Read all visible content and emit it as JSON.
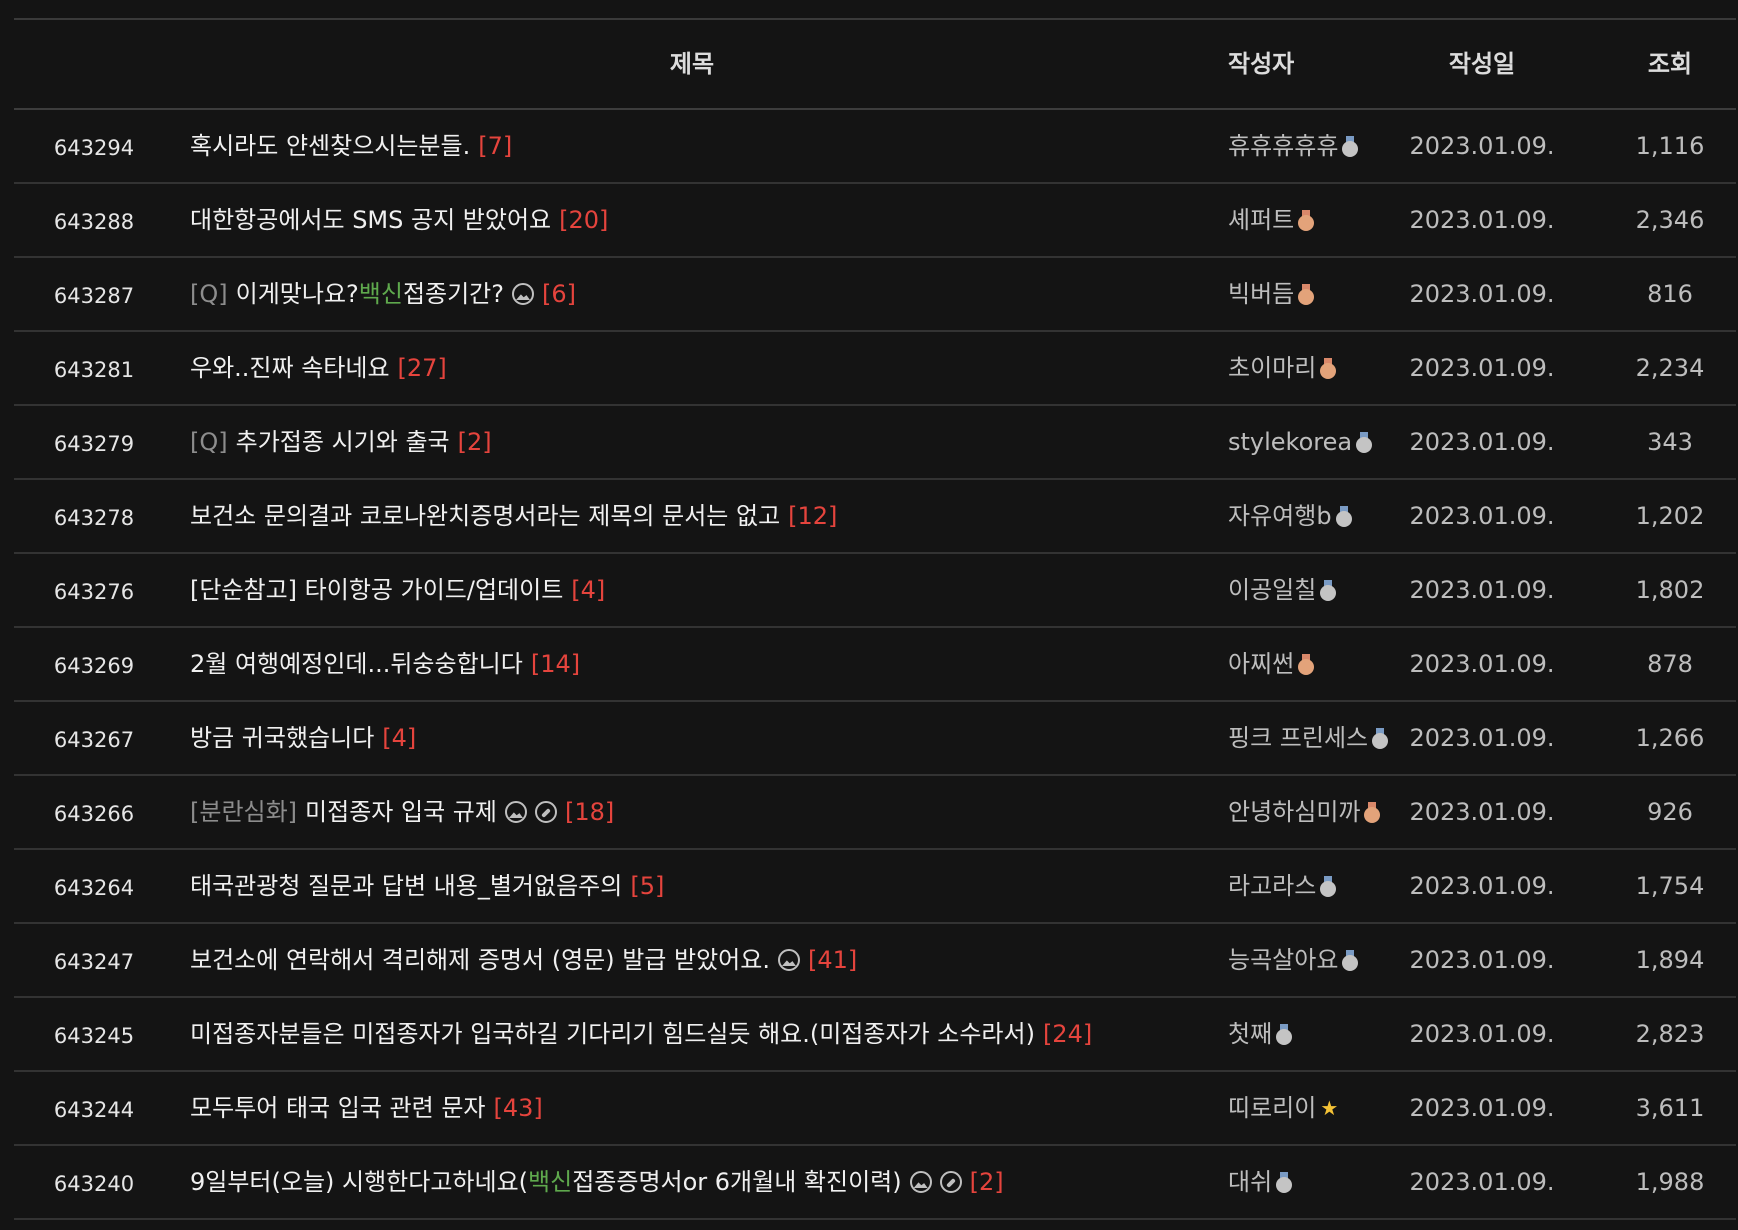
{
  "header": {
    "title": "제목",
    "author": "작성자",
    "date": "작성일",
    "views": "조회"
  },
  "colors": {
    "background": "#141414",
    "comment_count": "#e5443d",
    "highlight": "#5fa94d",
    "prefix": "#8d8d8d"
  },
  "posts": [
    {
      "num": "643294",
      "prefix": "",
      "parts": [
        {
          "t": "혹시라도 얀센찾으시는분들."
        }
      ],
      "icons": [],
      "comments": "[7]",
      "author": "휴휴휴휴휴",
      "medal": "silver",
      "date": "2023.01.09.",
      "views": "1,116"
    },
    {
      "num": "643288",
      "prefix": "",
      "parts": [
        {
          "t": "대한항공에서도 SMS 공지 받았어요"
        }
      ],
      "icons": [],
      "comments": "[20]",
      "author": "셰퍼트",
      "medal": "bronze",
      "date": "2023.01.09.",
      "views": "2,346"
    },
    {
      "num": "643287",
      "prefix": "[Q]",
      "parts": [
        {
          "t": "이게맞나요?"
        },
        {
          "t": "백신",
          "hl": true
        },
        {
          "t": "접종기간?"
        }
      ],
      "icons": [
        "image-icon"
      ],
      "comments": "[6]",
      "author": "빅버듬",
      "medal": "bronze",
      "date": "2023.01.09.",
      "views": "816"
    },
    {
      "num": "643281",
      "prefix": "",
      "parts": [
        {
          "t": "우와..진짜 속타네요"
        }
      ],
      "icons": [],
      "comments": "[27]",
      "author": "초이마리",
      "medal": "bronze",
      "date": "2023.01.09.",
      "views": "2,234"
    },
    {
      "num": "643279",
      "prefix": "[Q]",
      "parts": [
        {
          "t": "추가접종 시기와 출국"
        }
      ],
      "icons": [],
      "comments": "[2]",
      "author": "stylekorea",
      "medal": "silver",
      "date": "2023.01.09.",
      "views": "343"
    },
    {
      "num": "643278",
      "prefix": "",
      "parts": [
        {
          "t": "보건소 문의결과 코로나완치증명서라는 제목의 문서는 없고"
        }
      ],
      "icons": [],
      "comments": "[12]",
      "author": "자유여행b",
      "medal": "silver",
      "date": "2023.01.09.",
      "views": "1,202"
    },
    {
      "num": "643276",
      "prefix": "",
      "parts": [
        {
          "t": "[단순참고] 타이항공 가이드/업데이트"
        }
      ],
      "icons": [],
      "comments": "[4]",
      "author": "이공일칠",
      "medal": "silver",
      "date": "2023.01.09.",
      "views": "1,802"
    },
    {
      "num": "643269",
      "prefix": "",
      "parts": [
        {
          "t": "2월 여행예정인데...뒤숭숭합니다"
        }
      ],
      "icons": [],
      "comments": "[14]",
      "author": "아찌썬",
      "medal": "bronze",
      "date": "2023.01.09.",
      "views": "878"
    },
    {
      "num": "643267",
      "prefix": "",
      "parts": [
        {
          "t": "방금 귀국했습니다"
        }
      ],
      "icons": [],
      "comments": "[4]",
      "author": "핑크 프린세스",
      "medal": "silver",
      "date": "2023.01.09.",
      "views": "1,266"
    },
    {
      "num": "643266",
      "prefix": "[분란심화]",
      "parts": [
        {
          "t": "미접종자 입국 규제"
        }
      ],
      "icons": [
        "image-icon",
        "link-icon"
      ],
      "comments": "[18]",
      "author": "안녕하심미까",
      "medal": "bronze",
      "date": "2023.01.09.",
      "views": "926"
    },
    {
      "num": "643264",
      "prefix": "",
      "parts": [
        {
          "t": "태국관광청 질문과 답변 내용_별거없음주의"
        }
      ],
      "icons": [],
      "comments": "[5]",
      "author": "라고라스",
      "medal": "silver",
      "date": "2023.01.09.",
      "views": "1,754"
    },
    {
      "num": "643247",
      "prefix": "",
      "parts": [
        {
          "t": "보건소에 연락해서 격리해제 증명서 (영문) 발급 받았어요."
        }
      ],
      "icons": [
        "image-icon"
      ],
      "comments": "[41]",
      "author": "능곡살아요",
      "medal": "silver",
      "date": "2023.01.09.",
      "views": "1,894"
    },
    {
      "num": "643245",
      "prefix": "",
      "parts": [
        {
          "t": "미접종자분들은 미접종자가 입국하길 기다리기 힘드실듯 해요.(미접종자가 소수라서)"
        }
      ],
      "icons": [],
      "comments": "[24]",
      "author": "첫째",
      "medal": "silver",
      "date": "2023.01.09.",
      "views": "2,823"
    },
    {
      "num": "643244",
      "prefix": "",
      "parts": [
        {
          "t": "모두투어 태국 입국 관련 문자"
        }
      ],
      "icons": [],
      "comments": "[43]",
      "author": "띠로리이",
      "medal": "star",
      "date": "2023.01.09.",
      "views": "3,611"
    },
    {
      "num": "643240",
      "prefix": "",
      "parts": [
        {
          "t": "9일부터(오늘) 시행한다고하네요("
        },
        {
          "t": "백신",
          "hl": true
        },
        {
          "t": "접종증명서or 6개월내 확진이력)"
        }
      ],
      "icons": [
        "image-icon",
        "link-icon"
      ],
      "comments": "[2]",
      "author": "대쉬",
      "medal": "silver",
      "date": "2023.01.09.",
      "views": "1,988"
    }
  ]
}
